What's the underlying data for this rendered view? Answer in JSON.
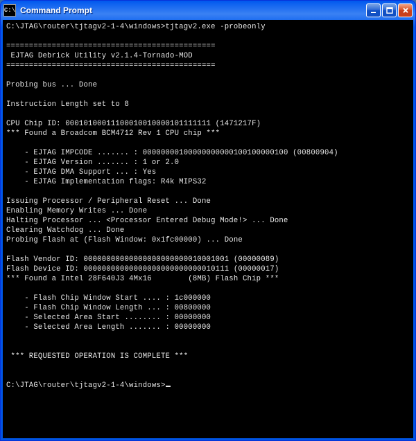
{
  "window": {
    "title": "Command Prompt",
    "icon_label": "C:\\"
  },
  "terminal": {
    "prompt_line": "C:\\JTAG\\router\\tjtagv2-1-4\\windows>tjtagv2.exe -probeonly",
    "divider_top": "==============================================",
    "banner": " EJTAG Debrick Utility v2.1.4-Tornado-MOD",
    "divider_bottom": "==============================================",
    "probe_bus": "Probing bus ... Done",
    "instr_len": "Instruction Length set to 8",
    "cpu_id": "CPU Chip ID: 00010100011100010010000101111111 (1471217F)",
    "cpu_found": "*** Found a Broadcom BCM4712 Rev 1 CPU chip ***",
    "impcode": "    - EJTAG IMPCODE ....... : 00000000100000000000100100000100 (00800904)",
    "version": "    - EJTAG Version ....... : 1 or 2.0",
    "dma": "    - EJTAG DMA Support ... : Yes",
    "impflags": "    - EJTAG Implementation flags: R4k MIPS32",
    "reset": "Issuing Processor / Peripheral Reset ... Done",
    "mem": "Enabling Memory Writes ... Done",
    "halt": "Halting Processor ... <Processor Entered Debug Mode!> ... Done",
    "watchdog": "Clearing Watchdog ... Done",
    "flashprobe": "Probing Flash at (Flash Window: 0x1fc00000) ... Done",
    "vendor": "Flash Vendor ID: 00000000000000000000000010001001 (00000089)",
    "device": "Flash Device ID: 00000000000000000000000000010111 (00000017)",
    "chipfound": "*** Found a Intel 28F640J3 4Mx16        (8MB) Flash Chip ***",
    "winstart": "    - Flash Chip Window Start .... : 1c000000",
    "winlen": "    - Flash Chip Window Length ... : 00800000",
    "areastart": "    - Selected Area Start ........ : 00000000",
    "arealen": "    - Selected Area Length ....... : 00000000",
    "complete": " *** REQUESTED OPERATION IS COMPLETE ***",
    "end_prompt": "C:\\JTAG\\router\\tjtagv2-1-4\\windows>"
  }
}
